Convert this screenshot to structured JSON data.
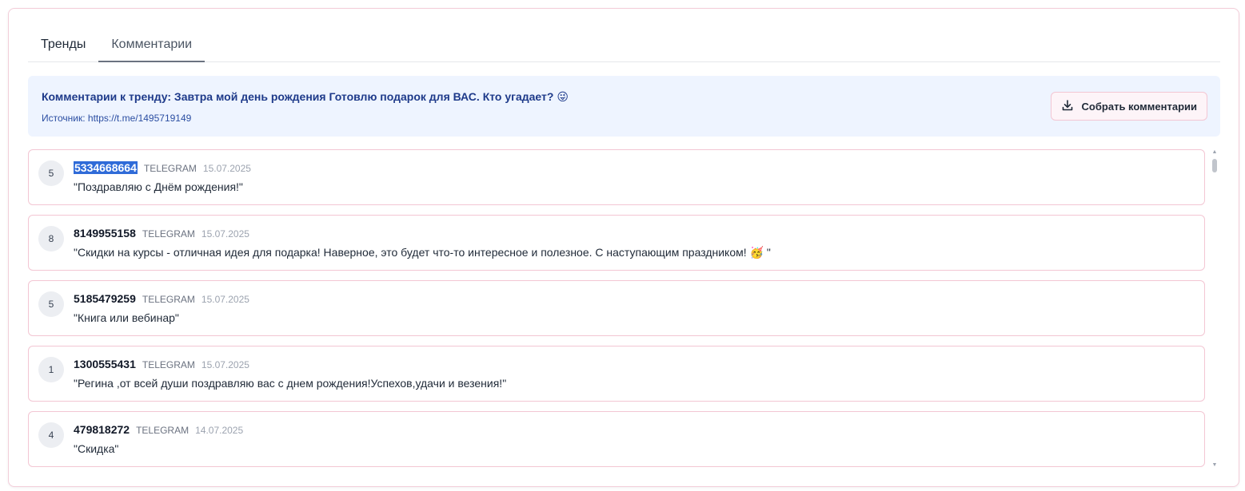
{
  "tabs": [
    {
      "label": "Тренды",
      "active": false
    },
    {
      "label": "Комментарии",
      "active": true
    }
  ],
  "banner": {
    "title": "Комментарии к тренду: Завтра мой день рождения Готовлю подарок для ВАС. Кто угадает? 😜",
    "source": "Источник: https://t.me/1495719149",
    "collect_button": "Собрать комментарии",
    "collect_icon": "download-icon"
  },
  "comments": [
    {
      "score": "5",
      "author": "5334668664",
      "platform": "TELEGRAM",
      "date": "15.07.2025",
      "text": "\"Поздравляю  с  Днём рождения!\"",
      "author_selected": true
    },
    {
      "score": "8",
      "author": "8149955158",
      "platform": "TELEGRAM",
      "date": "15.07.2025",
      "text": "\"Скидки на курсы - отличная идея для подарка! Наверное, это будет что-то интересное и полезное. С наступающим праздником! 🥳 \""
    },
    {
      "score": "5",
      "author": "5185479259",
      "platform": "TELEGRAM",
      "date": "15.07.2025",
      "text": "\"Книга или вебинар\""
    },
    {
      "score": "1",
      "author": "1300555431",
      "platform": "TELEGRAM",
      "date": "15.07.2025",
      "text": "\"Регина ,от всей души поздравляю вас с днем рождения!Успехов,удачи и везения!\""
    },
    {
      "score": "4",
      "author": "479818272",
      "platform": "TELEGRAM",
      "date": "14.07.2025",
      "text": "\"Скидка\""
    }
  ],
  "colors": {
    "accent_border": "#f3c6d3",
    "banner_bg": "#eef4ff",
    "banner_title": "#1e3a8a",
    "selection": "#2f6bd8"
  }
}
